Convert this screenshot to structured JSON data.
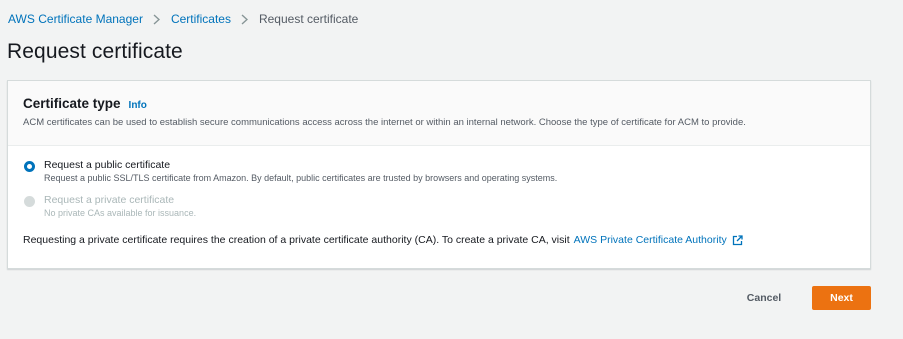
{
  "breadcrumb": {
    "items": [
      "AWS Certificate Manager",
      "Certificates",
      "Request certificate"
    ]
  },
  "page": {
    "title": "Request certificate"
  },
  "panel": {
    "title": "Certificate type",
    "info": "Info",
    "description": "ACM certificates can be used to establish secure communications access across the internet or within an internal network. Choose the type of certificate for ACM to provide.",
    "options": [
      {
        "label": "Request a public certificate",
        "description": "Request a public SSL/TLS certificate from Amazon. By default, public certificates are trusted by browsers and operating systems.",
        "selected": true
      },
      {
        "label": "Request a private certificate",
        "description": "No private CAs available for issuance.",
        "disabled": true
      }
    ],
    "note": "Requesting a private certificate requires the creation of a private certificate authority (CA). To create a private CA, visit",
    "note_link": "AWS Private Certificate Authority"
  },
  "footer": {
    "cancel": "Cancel",
    "next": "Next"
  },
  "colors": {
    "link": "#0073bb",
    "primary_button": "#ec7211",
    "background": "#f2f3f3"
  },
  "icons": {
    "breadcrumb_separator": "chevron-right-icon",
    "external_link": "external-link-icon"
  }
}
